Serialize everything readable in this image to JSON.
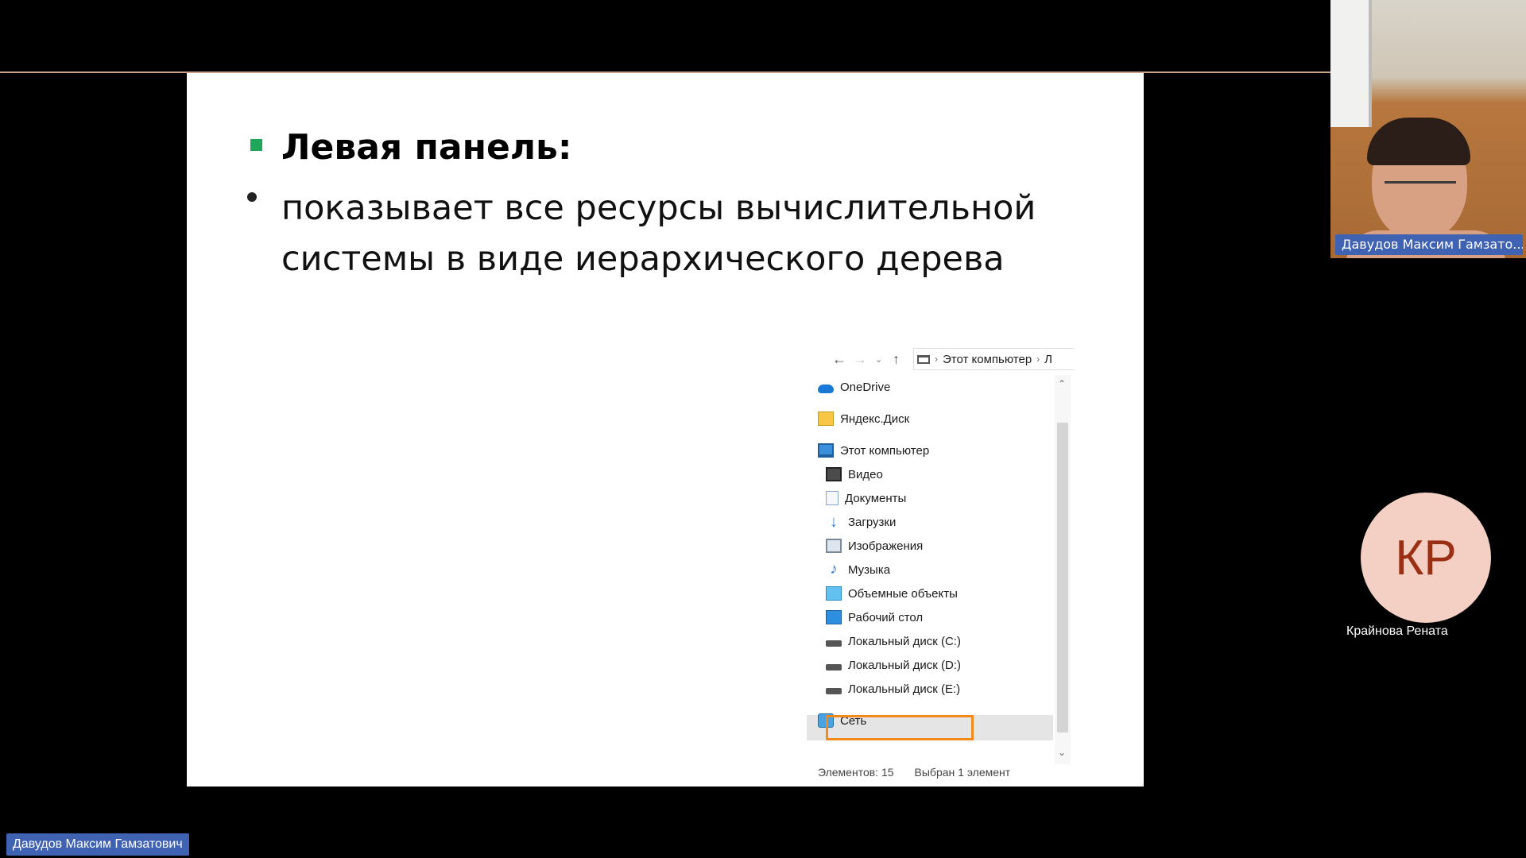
{
  "slide": {
    "heading": "Левая панель:",
    "body": "показывает все ресурсы вычислительной системы в виде иерархического дерева",
    "colors": {
      "square_bullet": "#1ea65a",
      "selection_frame": "#f28a1b"
    }
  },
  "explorer": {
    "toolbar": {
      "back_icon": "arrow-left-icon",
      "forward_icon": "arrow-right-icon",
      "recent_icon": "chevron-down-icon",
      "up_icon": "arrow-up-icon"
    },
    "address": {
      "segment_1": "Этот компьютер",
      "segment_2": "Л"
    },
    "tree": [
      {
        "label": "OneDrive",
        "icon": "cloud-icon"
      },
      {
        "label": "Яндекс.Диск",
        "icon": "yandex-disk-icon"
      },
      {
        "label": "Этот компьютер",
        "icon": "computer-icon"
      },
      {
        "label": "Видео",
        "icon": "video-folder-icon"
      },
      {
        "label": "Документы",
        "icon": "documents-folder-icon"
      },
      {
        "label": "Загрузки",
        "icon": "downloads-folder-icon"
      },
      {
        "label": "Изображения",
        "icon": "pictures-folder-icon"
      },
      {
        "label": "Музыка",
        "icon": "music-folder-icon"
      },
      {
        "label": "Объемные объекты",
        "icon": "3d-objects-folder-icon"
      },
      {
        "label": "Рабочий стол",
        "icon": "desktop-folder-icon"
      },
      {
        "label": "Локальный диск (C:)",
        "icon": "drive-icon",
        "selected": true
      },
      {
        "label": "Локальный диск (D:)",
        "icon": "drive-icon"
      },
      {
        "label": "Локальный диск (E:)",
        "icon": "drive-icon"
      },
      {
        "label": "Сеть",
        "icon": "network-icon"
      }
    ],
    "status": {
      "count": "Элементов: 15",
      "selection": "Выбран 1 элемент"
    }
  },
  "participants": {
    "camera_name": "Давудов Максим Гамзато...",
    "avatar_initials": "КР",
    "avatar_name": "Крайнова Рената",
    "self_name": "Давудов Максим Гамзатович"
  }
}
